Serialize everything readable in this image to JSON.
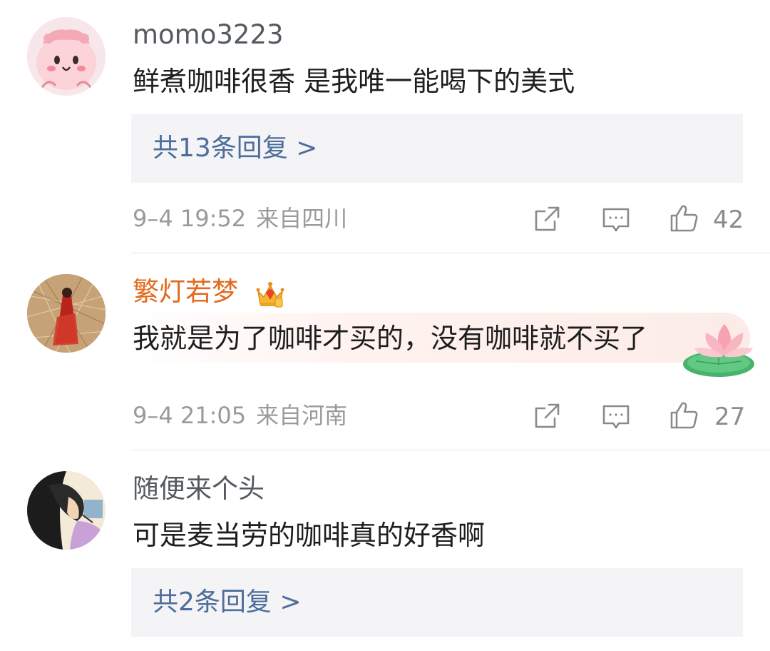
{
  "comments": [
    {
      "username": "momo3223",
      "text": "鲜煮咖啡很香 是我唯一能喝下的美式",
      "replies_label": "共13条回复 >",
      "time": "9–4 19:52",
      "location": "来自四川",
      "likes": "42"
    },
    {
      "username": "繁灯若梦",
      "text": "我就是为了咖啡才买的，没有咖啡就不买了",
      "time": "9–4 21:05",
      "location": "来自河南",
      "likes": "27"
    },
    {
      "username": "随便来个头",
      "text": "可是麦当劳的咖啡真的好香啊",
      "replies_label": "共2条回复 >"
    }
  ],
  "colors": {
    "vip_name": "#e36a1c",
    "reply_link": "#4d6d9a",
    "reply_bg": "#f4f4f6"
  },
  "icons": [
    "share-icon",
    "comment-icon",
    "like-icon",
    "vip-crown-icon",
    "lotus-sticker-icon"
  ]
}
